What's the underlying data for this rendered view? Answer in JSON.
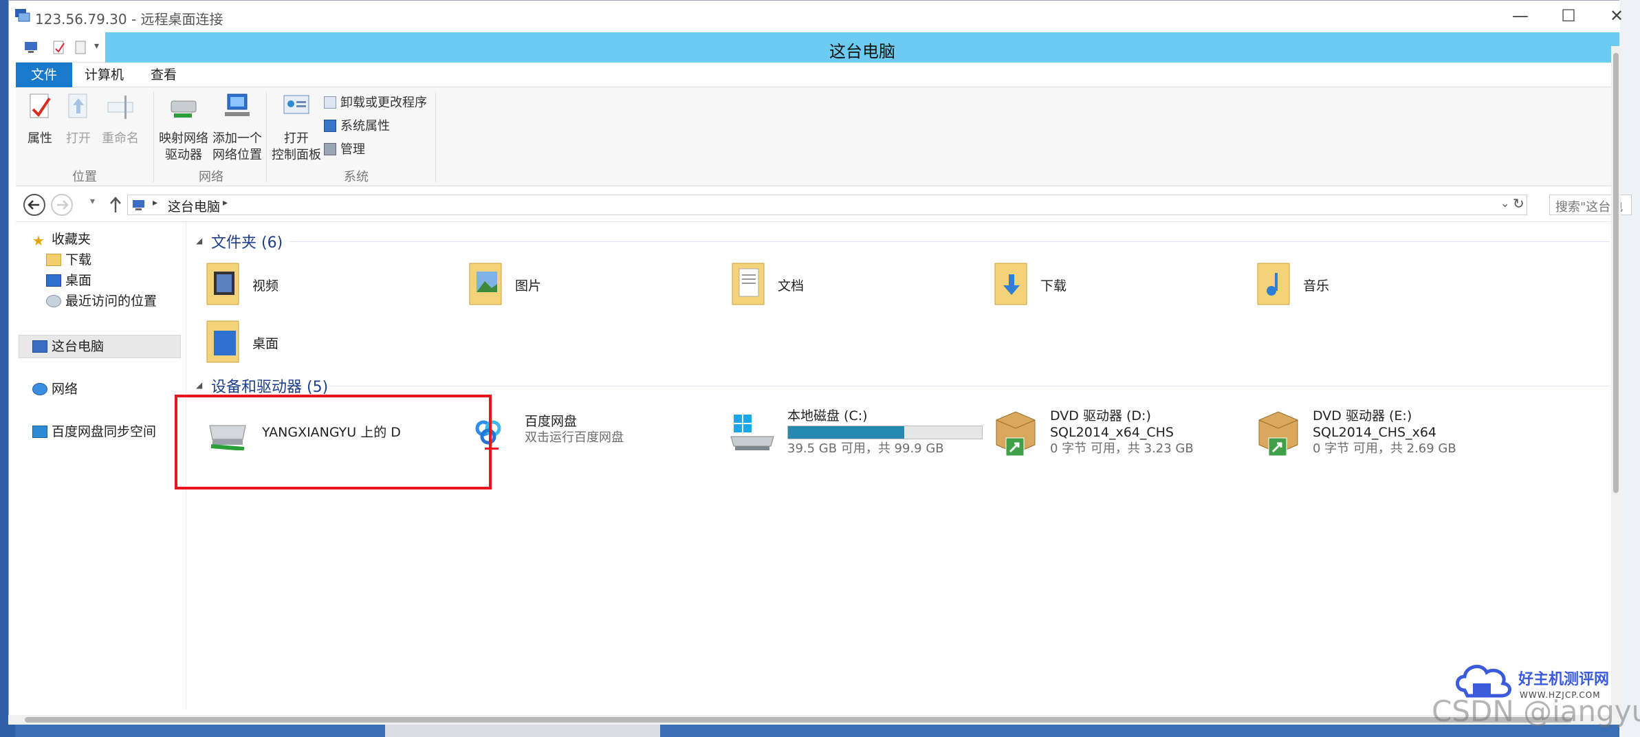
{
  "rdp": {
    "title": "123.56.79.30 - 远程桌面连接",
    "minimize": "—",
    "maximize": "☐",
    "close": "✕"
  },
  "explorer": {
    "title": "这台电脑"
  },
  "tabs": [
    {
      "label": "文件"
    },
    {
      "label": "计算机"
    },
    {
      "label": "查看"
    }
  ],
  "ribbon": {
    "properties": "属性",
    "open": "打开",
    "rename": "重命名",
    "map_drive_1": "映射网络",
    "map_drive_2": "驱动器",
    "add_location_1": "添加一个",
    "add_location_2": "网络位置",
    "control_panel_1": "打开",
    "control_panel_2": "控制面板",
    "uninstall": "卸载或更改程序",
    "system_props": "系统属性",
    "manage": "管理",
    "group_location": "位置",
    "group_network": "网络",
    "group_system": "系统"
  },
  "nav": {
    "path": "这台电脑",
    "search_placeholder": "搜索\"这台电"
  },
  "sidebar": {
    "favorites": "收藏夹",
    "downloads": "下载",
    "desktop": "桌面",
    "recent": "最近访问的位置",
    "this_pc": "这台电脑",
    "network": "网络",
    "baidu_sync": "百度网盘同步空间"
  },
  "folders_header": "文件夹 (6)",
  "folders": [
    {
      "name": "视频"
    },
    {
      "name": "图片"
    },
    {
      "name": "文档"
    },
    {
      "name": "下载"
    },
    {
      "name": "音乐"
    },
    {
      "name": "桌面"
    }
  ],
  "devices_header": "设备和驱动器 (5)",
  "devices": [
    {
      "name": "YANGXIANGYU 上的 D"
    },
    {
      "name": "百度网盘",
      "sub": "双击运行百度网盘"
    },
    {
      "name": "本地磁盘 (C:)",
      "sub": "39.5 GB 可用，共 99.9 GB",
      "used_fraction": 0.6
    },
    {
      "name": "DVD 驱动器 (D:)",
      "label": "SQL2014_x64_CHS",
      "sub": "0 字节 可用，共 3.23 GB"
    },
    {
      "name": "DVD 驱动器 (E:)",
      "label": "SQL2014_CHS_x64",
      "sub": "0 字节 可用，共 2.69 GB"
    }
  ],
  "watermark": {
    "site": "好主机测评网",
    "url": "WWW.HZJCP.COM",
    "csdn": "CSDN @iangyu"
  },
  "colors": {
    "accent": "#1979ca",
    "title_bar": "#6ccbf0",
    "highlight_box": "#e8141e",
    "disk_fill": "#2689b0"
  }
}
